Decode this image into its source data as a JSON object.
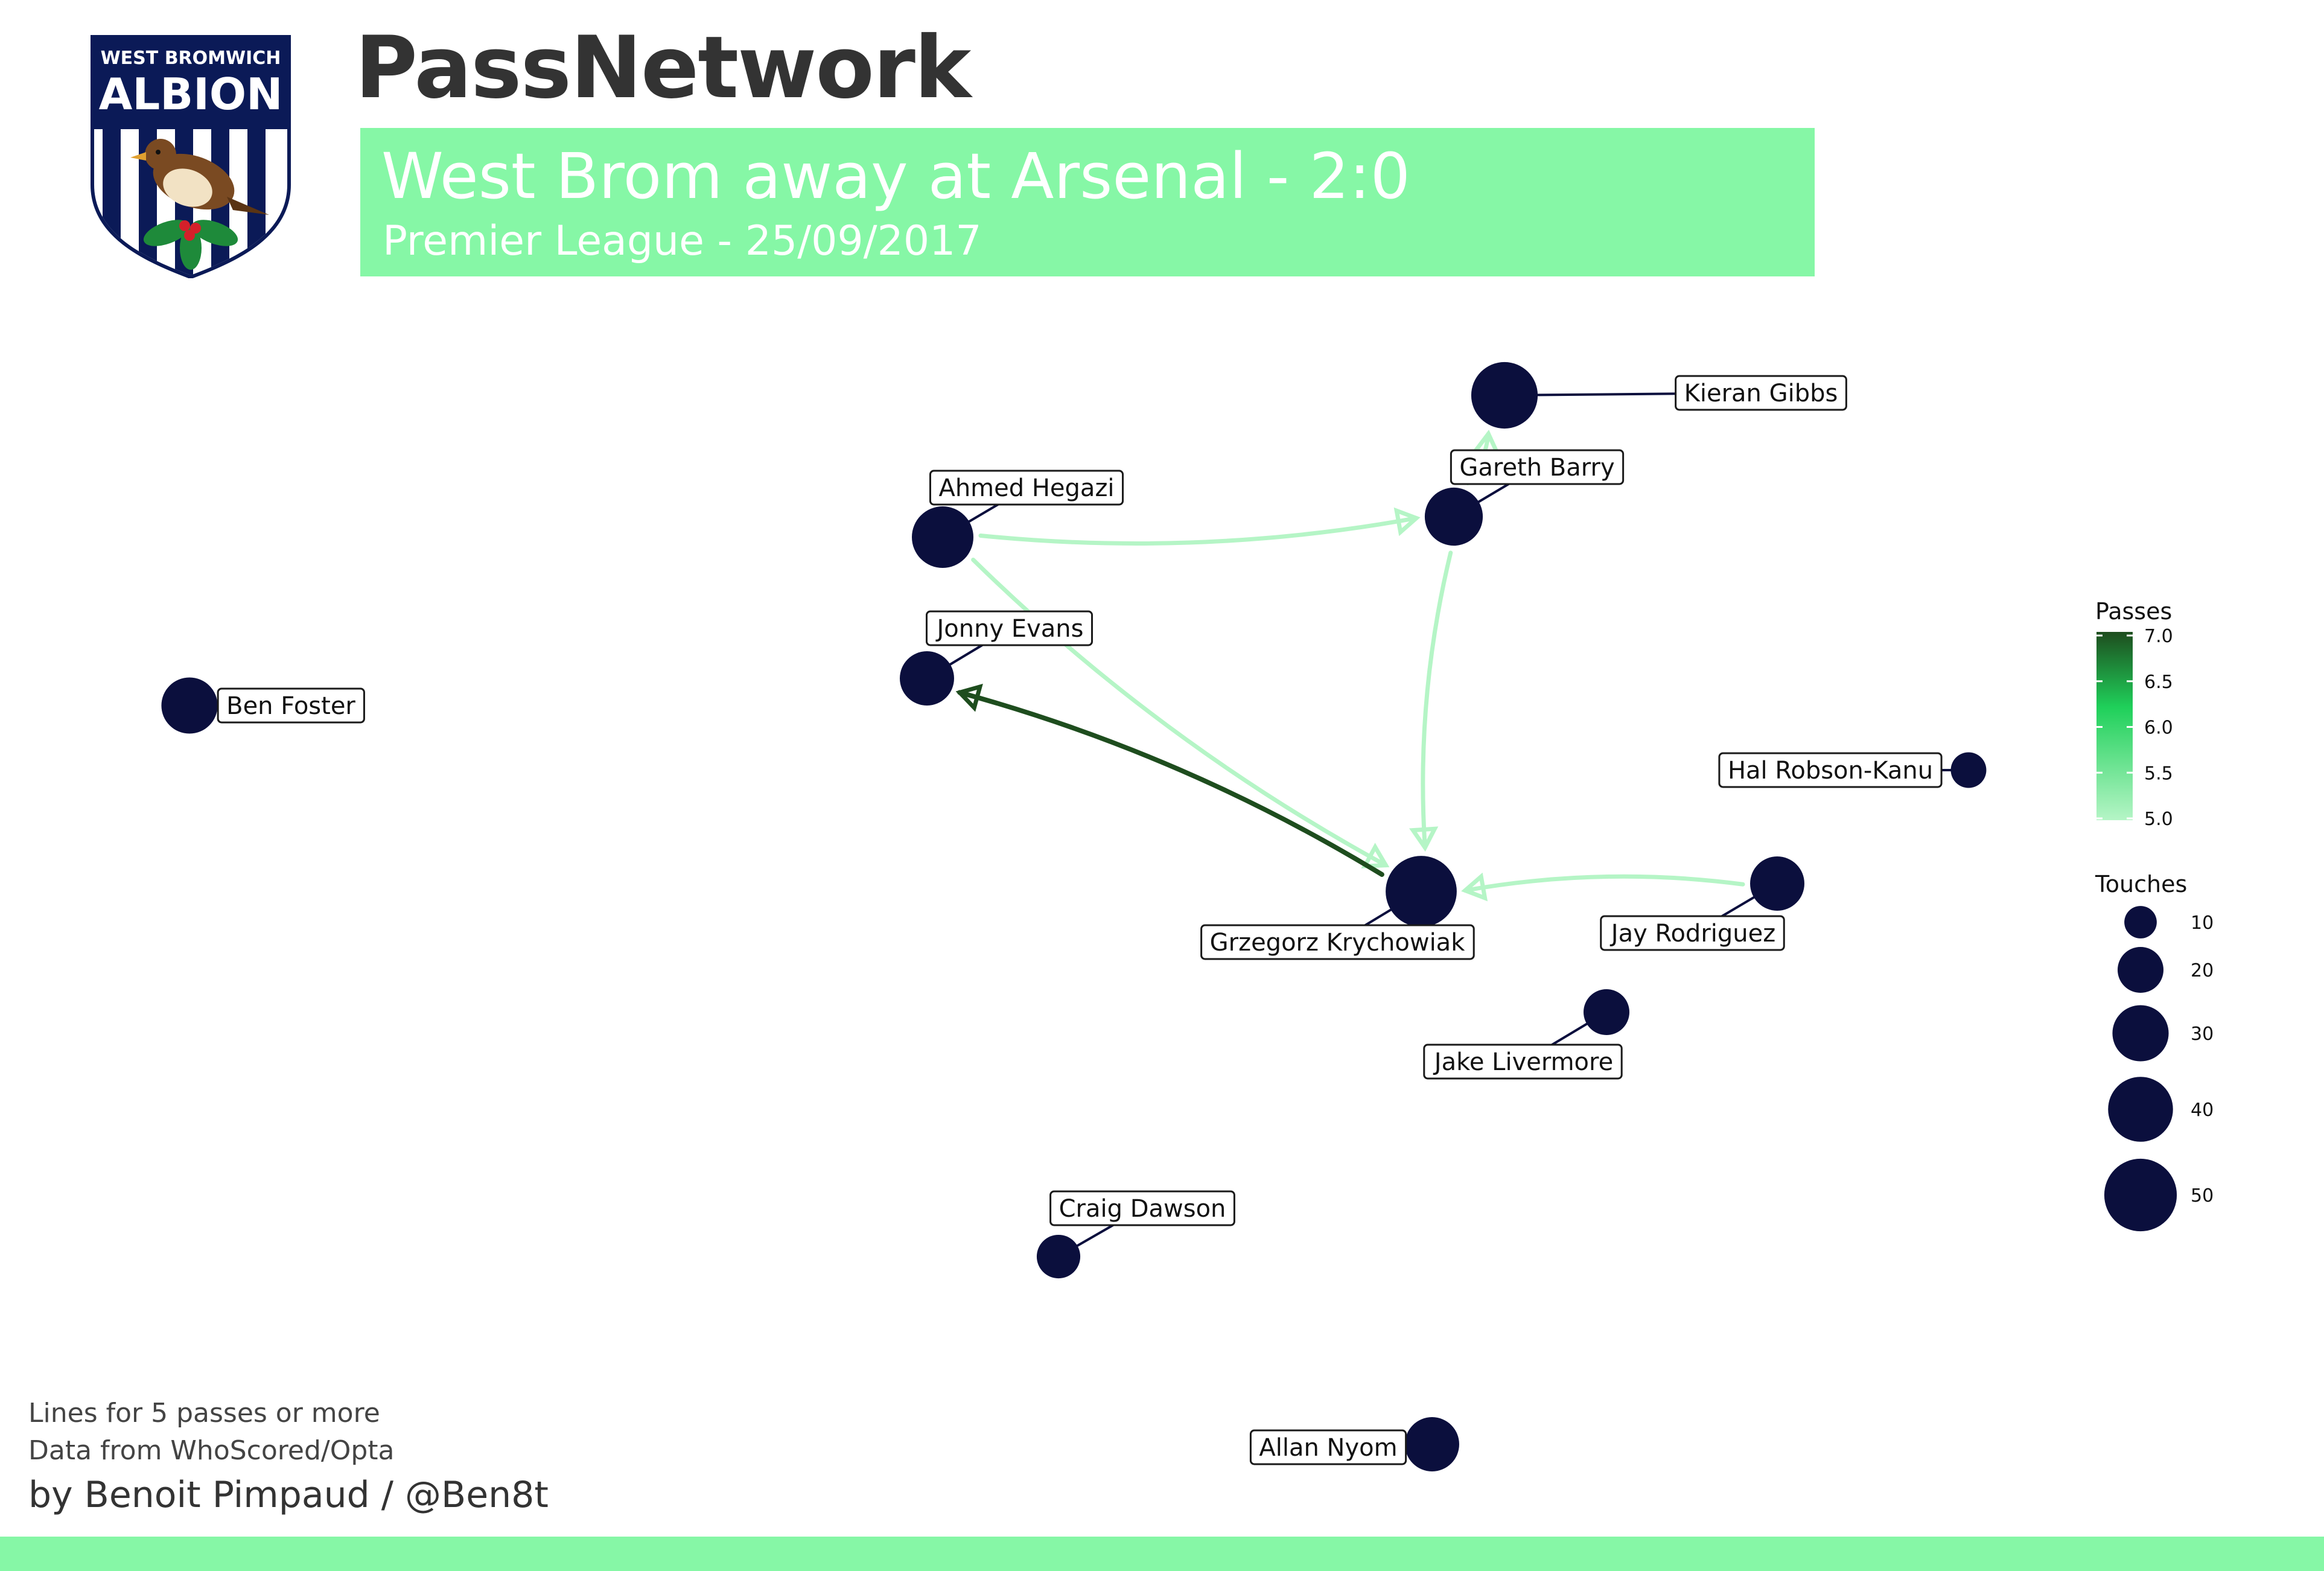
{
  "header": {
    "title": "PassNetwork",
    "match_title": "West Brom away at Arsenal - 2:0",
    "match_subtitle": "Premier League - 25/09/2017"
  },
  "crest": {
    "line1": "WEST BROMWICH",
    "line2": "ALBION",
    "icon": "west-bromwich-albion-crest"
  },
  "footer": {
    "note_1": "Lines for 5 passes or more",
    "note_2": "Data from WhoScored/Opta",
    "credit": "by Benoit Pimpaud / @Ben8t"
  },
  "colors": {
    "node": "#0b0f3d",
    "banner": "#86f7a6",
    "edge_low": "#b5f5c6",
    "edge_high": "#1e4d1e"
  },
  "legend": {
    "passes_title": "Passes",
    "passes_ticks": [
      "7.0",
      "6.5",
      "6.0",
      "5.5",
      "5.0"
    ],
    "touches_title": "Touches",
    "touches_ticks": [
      "10",
      "20",
      "30",
      "40",
      "50"
    ]
  },
  "players": [
    {
      "name": "Kieran Gibbs",
      "touches": 42
    },
    {
      "name": "Gareth Barry",
      "touches": 32
    },
    {
      "name": "Ahmed Hegazi",
      "touches": 36
    },
    {
      "name": "Jonny Evans",
      "touches": 28
    },
    {
      "name": "Ben Foster",
      "touches": 30
    },
    {
      "name": "Hal Robson-Kanu",
      "touches": 12
    },
    {
      "name": "Grzegorz Krychowiak",
      "touches": 48
    },
    {
      "name": "Jay Rodriguez",
      "touches": 28
    },
    {
      "name": "Jake Livermore",
      "touches": 20
    },
    {
      "name": "Craig Dawson",
      "touches": 18
    },
    {
      "name": "Allan Nyom",
      "touches": 28
    }
  ],
  "passes": [
    {
      "from": "Ahmed Hegazi",
      "to": "Gareth Barry",
      "count": 5
    },
    {
      "from": "Ahmed Hegazi",
      "to": "Grzegorz Krychowiak",
      "count": 5
    },
    {
      "from": "Gareth Barry",
      "to": "Kieran Gibbs",
      "count": 5
    },
    {
      "from": "Gareth Barry",
      "to": "Grzegorz Krychowiak",
      "count": 5
    },
    {
      "from": "Jay Rodriguez",
      "to": "Grzegorz Krychowiak",
      "count": 5
    },
    {
      "from": "Grzegorz Krychowiak",
      "to": "Jonny Evans",
      "count": 7
    }
  ]
}
